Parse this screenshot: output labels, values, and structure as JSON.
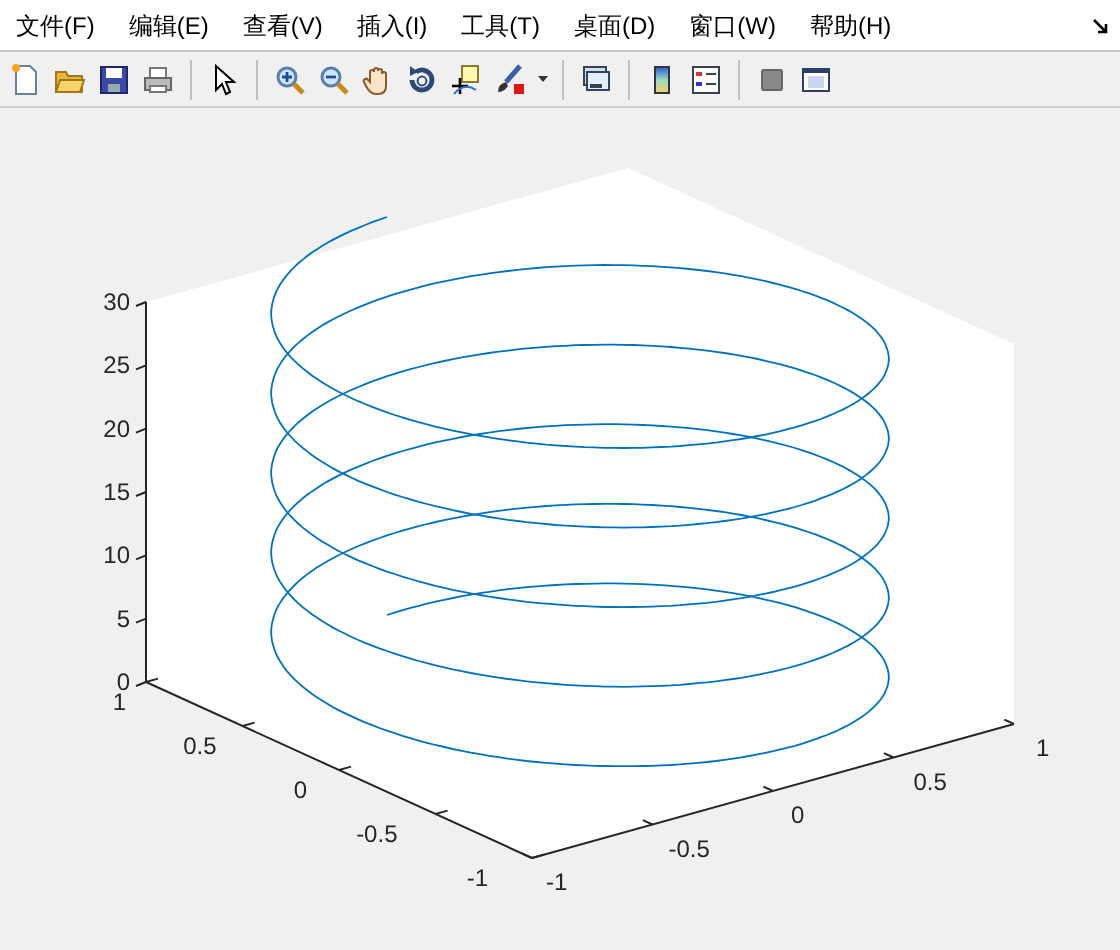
{
  "menu": [
    {
      "label": "文件(F)"
    },
    {
      "label": "编辑(E)"
    },
    {
      "label": "查看(V)"
    },
    {
      "label": "插入(I)"
    },
    {
      "label": "工具(T)"
    },
    {
      "label": "桌面(D)"
    },
    {
      "label": "窗口(W)"
    },
    {
      "label": "帮助(H)"
    }
  ],
  "plot": {
    "z_ticks": [
      "30",
      "25",
      "20",
      "15",
      "10",
      "5",
      "0"
    ],
    "y_ticks": [
      "1",
      "0.5",
      "0",
      "-0.5",
      "-1"
    ],
    "x_ticks": [
      "-1",
      "-0.5",
      "0",
      "0.5",
      "1"
    ]
  }
}
